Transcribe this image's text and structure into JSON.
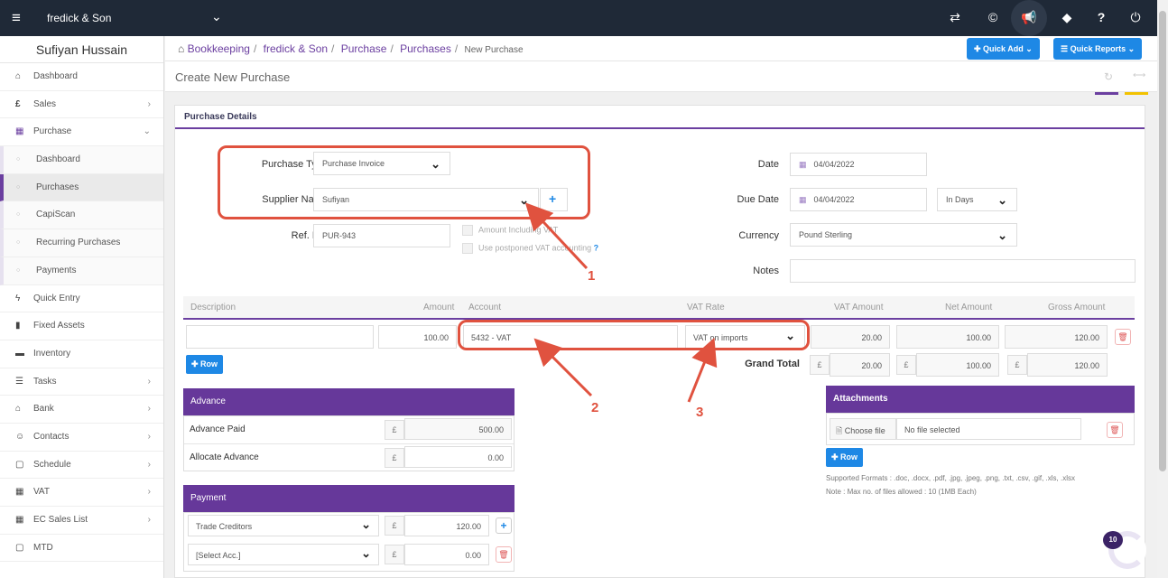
{
  "topbar": {
    "company": "fredick & Son",
    "icons": [
      "menu-icon",
      "chevron-down-icon",
      "transfer-icon",
      "copyright-icon",
      "megaphone-icon",
      "tag-icon",
      "help-icon",
      "power-icon"
    ]
  },
  "sidebar": {
    "user": "Sufiyan Hussain",
    "items": [
      {
        "label": "Dashboard",
        "icon": "home-icon"
      },
      {
        "label": "Sales",
        "icon": "pound-icon"
      },
      {
        "label": "Purchase",
        "icon": "purchase-icon"
      },
      {
        "label": "Dashboard",
        "sub": true
      },
      {
        "label": "Purchases",
        "sub": true,
        "active": true
      },
      {
        "label": "CapiScan",
        "sub": true
      },
      {
        "label": "Recurring Purchases",
        "sub": true
      },
      {
        "label": "Payments",
        "sub": true
      },
      {
        "label": "Quick Entry",
        "icon": "bolt-icon"
      },
      {
        "label": "Fixed Assets",
        "icon": "building-icon"
      },
      {
        "label": "Inventory",
        "icon": "truck-icon"
      },
      {
        "label": "Tasks",
        "icon": "tasks-icon"
      },
      {
        "label": "Bank",
        "icon": "bank-icon"
      },
      {
        "label": "Contacts",
        "icon": "contacts-icon"
      },
      {
        "label": "Schedule",
        "icon": "calendar-icon"
      },
      {
        "label": "VAT",
        "icon": "calculator-icon"
      },
      {
        "label": "EC Sales List",
        "icon": "calculator-icon"
      },
      {
        "label": "MTD",
        "icon": "calendar-icon"
      }
    ]
  },
  "breadcrumb": {
    "items": [
      "Bookkeeping",
      "fredick & Son",
      "Purchase",
      "Purchases"
    ],
    "current": "New Purchase",
    "separator": "/"
  },
  "header": {
    "quick_add": "Quick Add",
    "quick_reports": "Quick Reports",
    "page_title": "Create New Purchase"
  },
  "form": {
    "section_title": "Purchase Details",
    "purchase_type_label": "Purchase Type",
    "purchase_type_value": "Purchase Invoice",
    "supplier_label": "Supplier Name",
    "supplier_value": "Sufiyan",
    "ref_label": "Ref. No.",
    "ref_value": "PUR-943",
    "amount_incl_vat": "Amount Including VAT",
    "postponed_vat": "Use postponed VAT accounting",
    "help_mark": "?",
    "date_label": "Date",
    "date_value": "04/04/2022",
    "due_date_label": "Due Date",
    "due_date_value": "04/04/2022",
    "due_in": "In Days",
    "currency_label": "Currency",
    "currency_value": "Pound Sterling",
    "notes_label": "Notes"
  },
  "table": {
    "headers": [
      "Description",
      "Amount",
      "Account",
      "VAT Rate",
      "VAT Amount",
      "Net Amount",
      "Gross Amount"
    ],
    "row": {
      "amount": "100.00",
      "account": "5432 - VAT",
      "vat_rate": "VAT on imports",
      "vat_amount": "20.00",
      "net_amount": "100.00",
      "gross_amount": "120.00"
    },
    "add_row": "Row",
    "grand_total_label": "Grand Total",
    "currency_symbol": "£",
    "totals": {
      "vat": "20.00",
      "net": "100.00",
      "gross": "120.00"
    }
  },
  "advance": {
    "title": "Advance",
    "paid_label": "Advance Paid",
    "paid_value": "500.00",
    "allocate_label": "Allocate Advance",
    "allocate_value": "0.00"
  },
  "payment": {
    "title": "Payment",
    "rows": [
      {
        "account": "Trade Creditors",
        "value": "120.00"
      },
      {
        "account": "[Select Acc.]",
        "value": "0.00"
      }
    ]
  },
  "attachments": {
    "title": "Attachments",
    "choose": "Choose file",
    "no_file": "No file selected",
    "add_row": "Row",
    "formats": "Supported Formats : .doc, .docx, .pdf, .jpg, .jpeg, .png, .txt, .csv, .gif, .xls, .xlsx",
    "note": "Note : Max no. of files allowed : 10 (1MB Each)"
  },
  "annotations": [
    "1",
    "2",
    "3"
  ],
  "chat_badge": "10",
  "colors": {
    "brand_purple": "#66389a",
    "topbar": "#1f2937",
    "primary_blue": "#1e88e5",
    "annotation_red": "#e0523f"
  }
}
